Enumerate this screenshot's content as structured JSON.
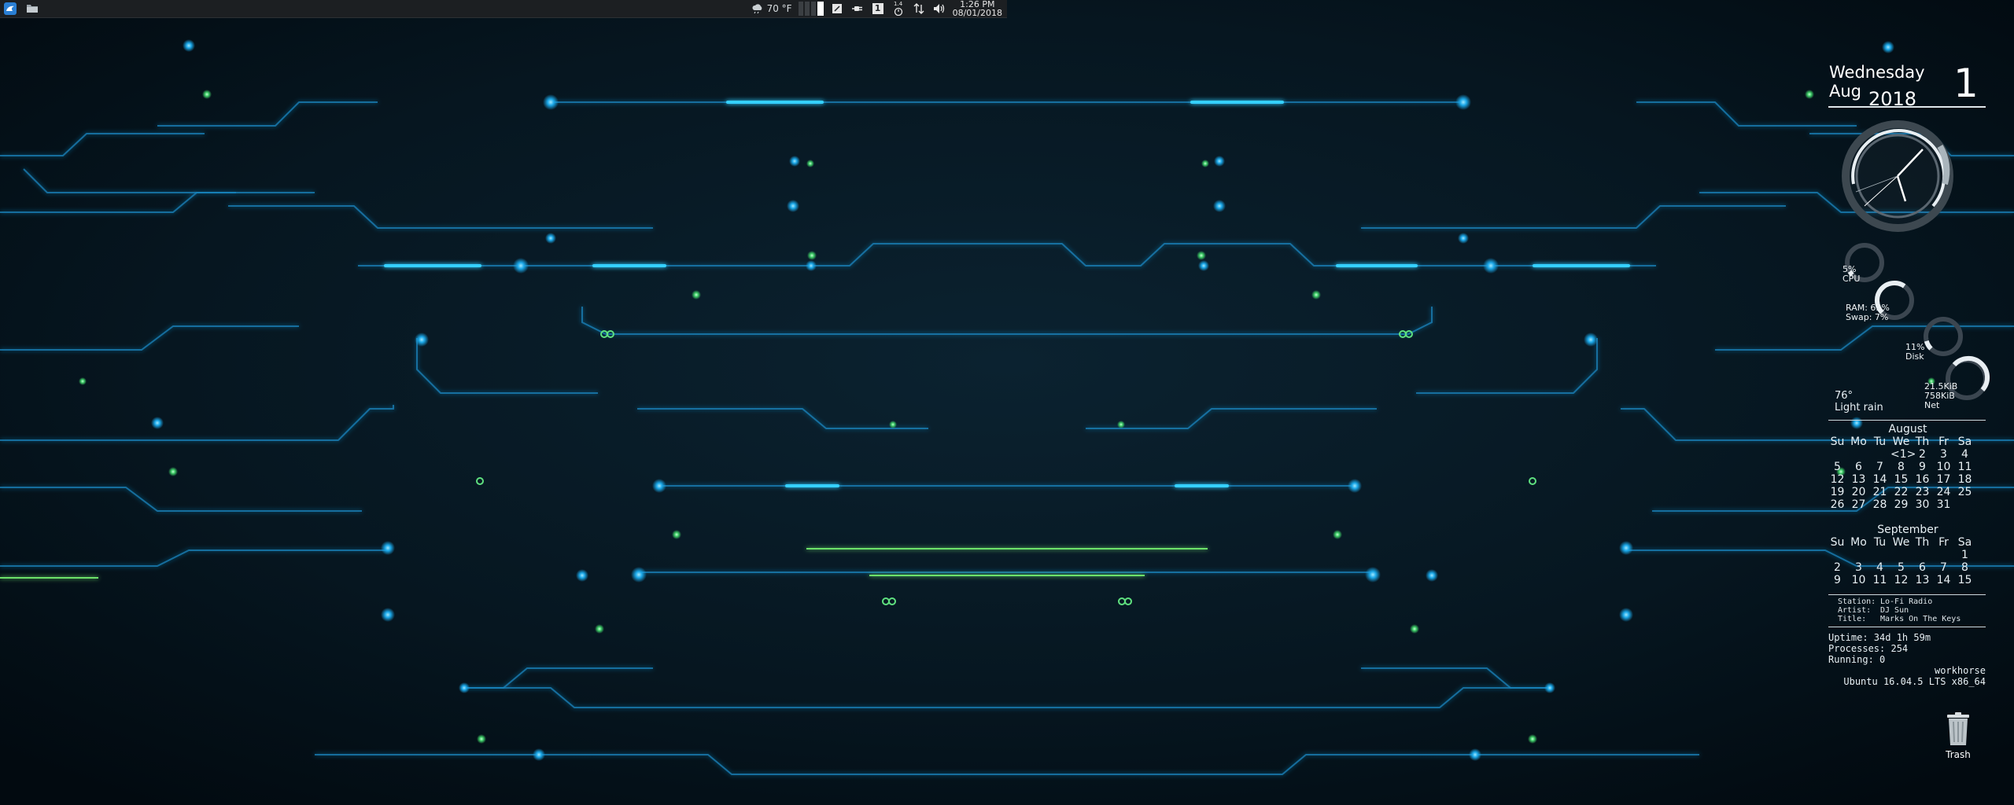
{
  "panel": {
    "weather_temp": "70 °F",
    "clock_time": "1:26 PM",
    "clock_date": "08/01/2018",
    "icons": [
      "app-menu-icon",
      "folder-icon",
      "weather-icon",
      "notes-icon",
      "power-plug-icon",
      "keyboard-layout-icon",
      "timer-icon",
      "network-icon",
      "volume-icon"
    ],
    "keyboard_layout": "1",
    "timer_label": "1.4"
  },
  "conky": {
    "weekday": "Wednesday",
    "month": "Aug",
    "year": "2018",
    "day": "1",
    "cpu_value": "5%",
    "cpu_label": "CPU",
    "ram_label": "RAM: 63%",
    "swap_label": "Swap: 7%",
    "disk_value": "11%",
    "disk_label": "Disk",
    "net_up": "21.5KiB",
    "net_down": "758KiB",
    "net_label": "Net",
    "cpu_percent": 5,
    "ram_percent": 63,
    "disk_percent": 11,
    "weather_temp": "76°",
    "weather_desc": "Light rain",
    "calendar": [
      {
        "title": "August",
        "headers": [
          "Su",
          "Mo",
          "Tu",
          "We",
          "Th",
          "Fr",
          "Sa"
        ],
        "rows": [
          [
            "",
            "",
            "",
            "<1>",
            "2",
            "3",
            "4"
          ],
          [
            "5",
            "6",
            "7",
            "8",
            "9",
            "10",
            "11"
          ],
          [
            "12",
            "13",
            "14",
            "15",
            "16",
            "17",
            "18"
          ],
          [
            "19",
            "20",
            "21",
            "22",
            "23",
            "24",
            "25"
          ],
          [
            "26",
            "27",
            "28",
            "29",
            "30",
            "31",
            ""
          ]
        ]
      },
      {
        "title": "September",
        "headers": [
          "Su",
          "Mo",
          "Tu",
          "We",
          "Th",
          "Fr",
          "Sa"
        ],
        "rows": [
          [
            "",
            "",
            "",
            "",
            "",
            "",
            "1"
          ],
          [
            "2",
            "3",
            "4",
            "5",
            "6",
            "7",
            "8"
          ],
          [
            "9",
            "10",
            "11",
            "12",
            "13",
            "14",
            "15"
          ]
        ]
      }
    ],
    "music": {
      "station_label": "Station:",
      "station": "Lo-Fi Radio",
      "artist_label": "Artist:",
      "artist": "DJ Sun",
      "title_label": "Title:",
      "title": "Marks On The Keys"
    },
    "uptime": "Uptime: 34d 1h 59m",
    "processes": "Processes: 254",
    "running": "Running: 0",
    "hostname": "workhorse",
    "os": "Ubuntu 16.04.5 LTS x86_64"
  },
  "desktop": {
    "trash_label": "Trash"
  },
  "colors": {
    "panel_bg": "#1c1f22",
    "wallpaper_line": "#1aa7e8",
    "wallpaper_glow": "#29c7ff",
    "wallpaper_green": "#5be07a"
  }
}
